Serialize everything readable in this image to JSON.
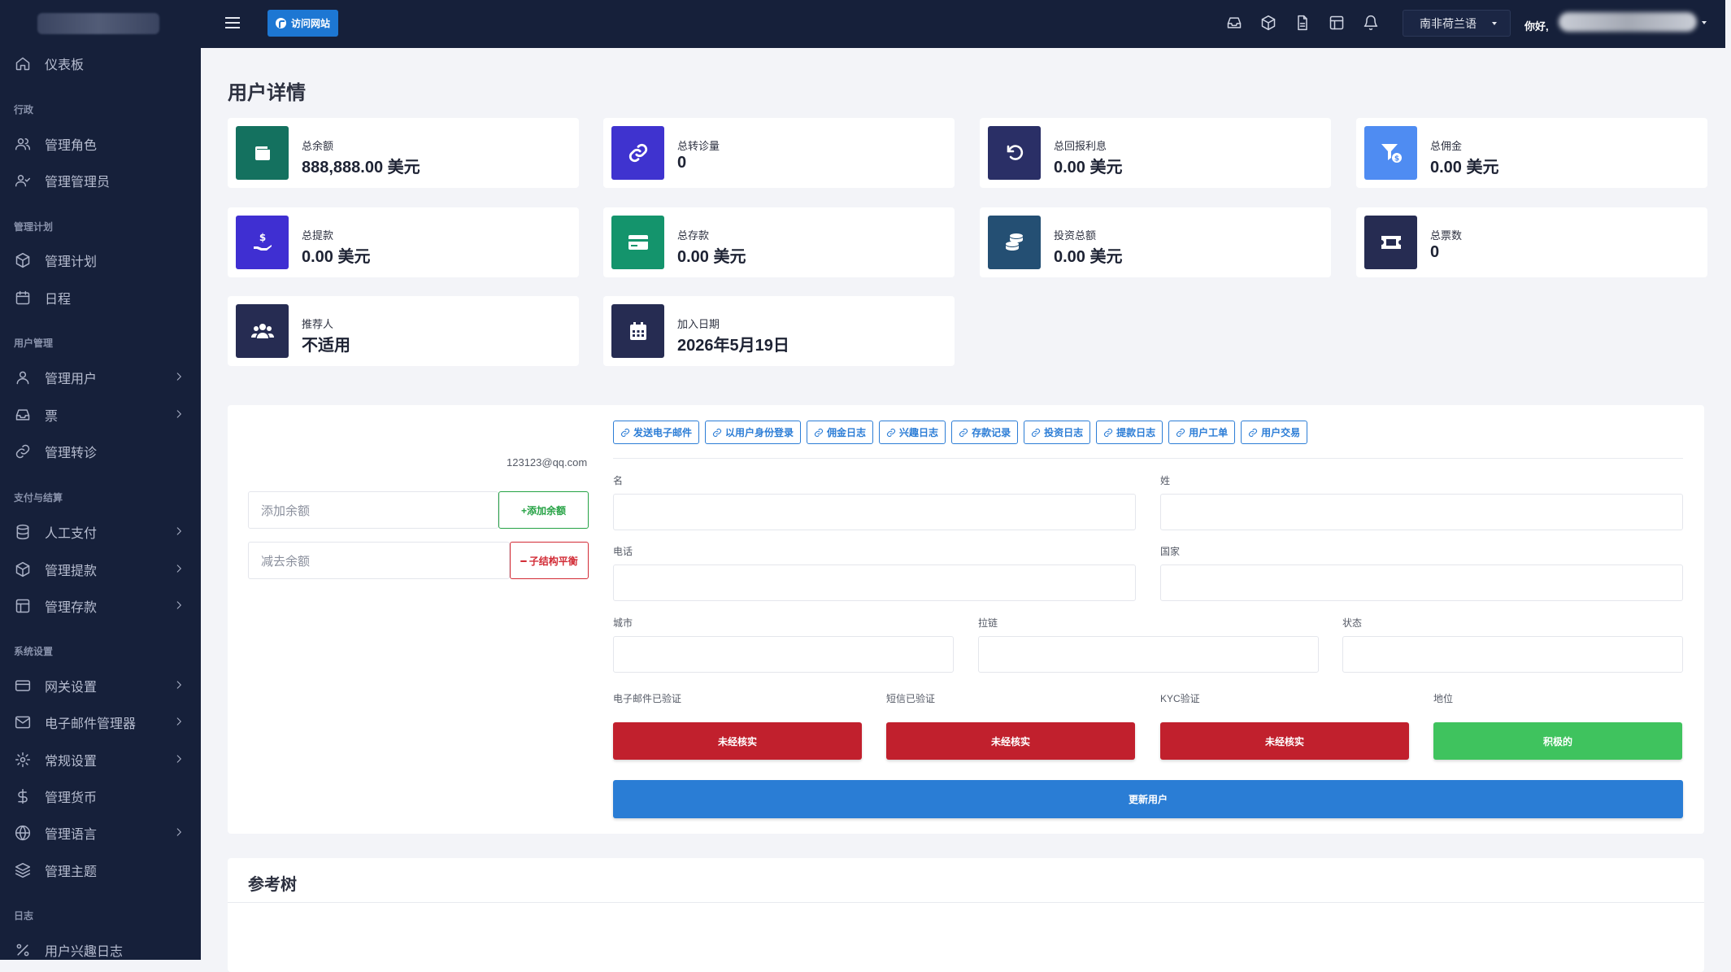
{
  "sidebar": {
    "sections": {
      "admin": "行政",
      "plans": "管理计划",
      "users": "用户管理",
      "payments": "支付与结算",
      "system": "系统设置",
      "logs": "日志"
    },
    "items": {
      "dashboard": "仪表板",
      "roles": "管理角色",
      "admins": "管理管理员",
      "plans": "管理计划",
      "schedule": "日程",
      "users": "管理用户",
      "tickets": "票",
      "transfers": "管理转诊",
      "manual_pay": "人工支付",
      "withdrawals": "管理提款",
      "deposits": "管理存款",
      "gateway": "网关设置",
      "email_mgr": "电子邮件管理器",
      "general": "常规设置",
      "currency": "管理货币",
      "language": "管理语言",
      "theme": "管理主题",
      "interest_log": "用户兴趣日志"
    }
  },
  "topbar": {
    "visit": "访问网站",
    "language": "南非荷兰语",
    "greeting": "你好,"
  },
  "page": {
    "title": "用户详情"
  },
  "cards": {
    "balance": {
      "title": "总余额",
      "value": "888,888.00 美元",
      "color": "#14715f"
    },
    "referrals": {
      "title": "总转诊量",
      "value": "0",
      "color": "#3f33cf"
    },
    "interest": {
      "title": "总回报利息",
      "value": "0.00 美元",
      "color": "#2a2f66"
    },
    "commission": {
      "title": "总佣金",
      "value": "0.00 美元",
      "color": "#4f8cf2"
    },
    "withdraw": {
      "title": "总提款",
      "value": "0.00 美元",
      "color": "#3f2fd2"
    },
    "deposit": {
      "title": "总存款",
      "value": "0.00 美元",
      "color": "#14946c"
    },
    "invest": {
      "title": "投资总额",
      "value": "0.00 美元",
      "color": "#244f73"
    },
    "tickets": {
      "title": "总票数",
      "value": "0",
      "color": "#262c52"
    },
    "referrer": {
      "title": "推荐人",
      "value": "不适用",
      "color": "#262c52"
    },
    "joined": {
      "title": "加入日期",
      "value": "2026年5月19日",
      "color": "#262c52"
    }
  },
  "detail": {
    "email": "123123@qq.com",
    "add_placeholder": "添加余额",
    "add_button": "+添加余额",
    "sub_placeholder": "减去余额",
    "sub_button": "━ 子结构平衡",
    "links": [
      "发送电子邮件",
      "以用户身份登录",
      "佣金日志",
      "兴趣日志",
      "存款记录",
      "投资日志",
      "提款日志",
      "用户工单",
      "用户交易"
    ],
    "fields": {
      "first_name": "名",
      "last_name": "姓",
      "phone": "电话",
      "country": "国家",
      "city": "城市",
      "zip": "拉链",
      "state": "状态",
      "email_verified": "电子邮件已验证",
      "sms_verified": "短信已验证",
      "kyc": "KYC验证",
      "status": "地位"
    },
    "status_values": {
      "email_verified": "未经核实",
      "sms_verified": "未经核实",
      "kyc": "未经核实",
      "status": "积极的"
    },
    "update_button": "更新用户"
  },
  "reference": {
    "title": "参考树"
  },
  "colors": {
    "danger": "#c1202d",
    "success": "#3fc35e",
    "primary": "#2a7dd5"
  }
}
